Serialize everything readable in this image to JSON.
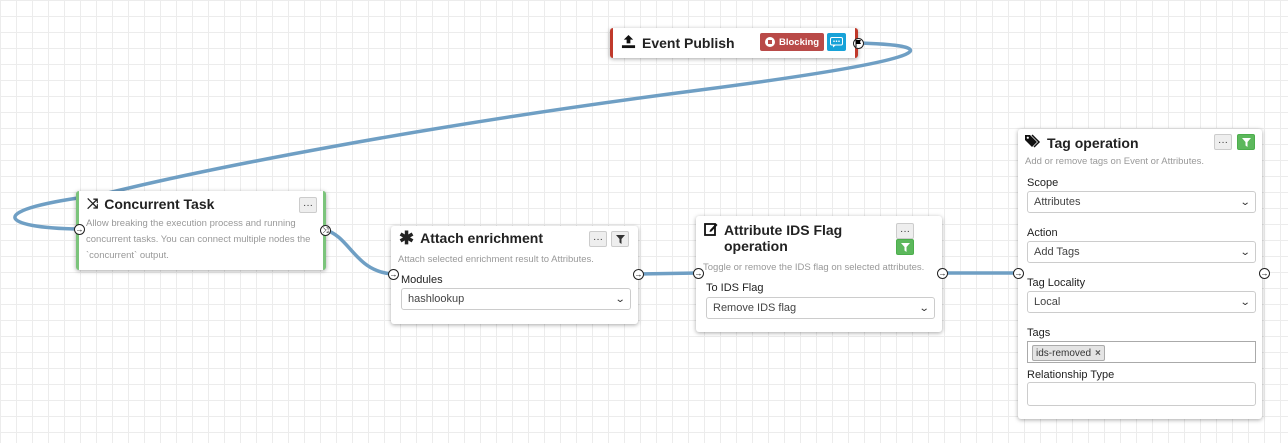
{
  "nodes": {
    "event_publish": {
      "title": "Event Publish",
      "badge": "Blocking"
    },
    "concurrent_task": {
      "title": "Concurrent Task",
      "description": "Allow breaking the execution process and running concurrent tasks. You can connect multiple nodes the `concurrent` output.",
      "menu": "···"
    },
    "attach_enrichment": {
      "title": "Attach enrichment",
      "description": "Attach selected enrichment result to Attributes.",
      "modules_label": "Modules",
      "modules_value": "hashlookup",
      "menu": "···"
    },
    "attribute_ids_flag": {
      "title_line1": "Attribute IDS Flag",
      "title_line2": "operation",
      "description": "Toggle or remove the IDS flag on selected attributes.",
      "field_label": "To IDS Flag",
      "field_value": "Remove IDS flag",
      "menu": "···"
    },
    "tag_operation": {
      "title": "Tag operation",
      "description": "Add or remove tags on Event or Attributes.",
      "scope_label": "Scope",
      "scope_value": "Attributes",
      "action_label": "Action",
      "action_value": "Add Tags",
      "locality_label": "Tag Locality",
      "locality_value": "Local",
      "tags_label": "Tags",
      "tag_chip": "ids-removed",
      "tag_remove": "×",
      "relationship_label": "Relationship Type",
      "relationship_value": "",
      "menu": "···"
    }
  },
  "colors": {
    "wire": "#6f9fc4",
    "blocking_badge": "#b94a48",
    "green_button": "#5cb85c",
    "info_button": "#17a2d8",
    "node_border_green": "#7bc47b",
    "node_border_red": "#c0392b"
  }
}
